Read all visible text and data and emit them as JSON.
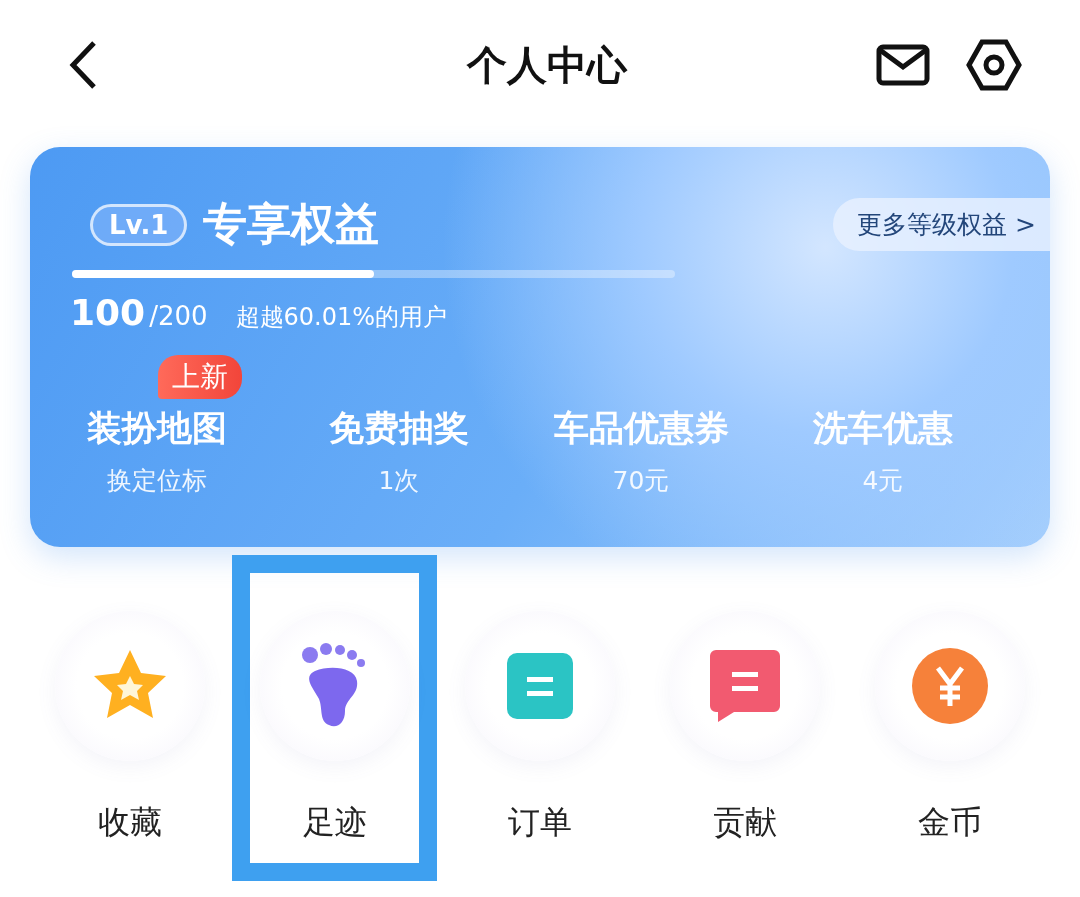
{
  "header": {
    "title": "个人中心"
  },
  "level_card": {
    "badge": "Lv.1",
    "title": "专享权益",
    "more_link": "更多等级权益 >",
    "progress": {
      "level": 0.5
    },
    "points": "100",
    "points_total": "/200",
    "rank_text": "超越60.01%的用户",
    "benefits": [
      {
        "title": "装扮地图",
        "subtitle": "换定位标",
        "tag": "上新"
      },
      {
        "title": "免费抽奖",
        "subtitle": "1次"
      },
      {
        "title": "车品优惠券",
        "subtitle": "70元"
      },
      {
        "title": "洗车优惠",
        "subtitle": "4元"
      }
    ]
  },
  "shortcuts": [
    {
      "kind": "star",
      "label": "收藏",
      "highlighted": false
    },
    {
      "kind": "foot",
      "label": "足迹",
      "highlighted": true
    },
    {
      "kind": "order",
      "label": "订单",
      "highlighted": false
    },
    {
      "kind": "chat",
      "label": "贡献",
      "highlighted": false
    },
    {
      "kind": "coin",
      "label": "金币",
      "highlighted": false
    }
  ]
}
